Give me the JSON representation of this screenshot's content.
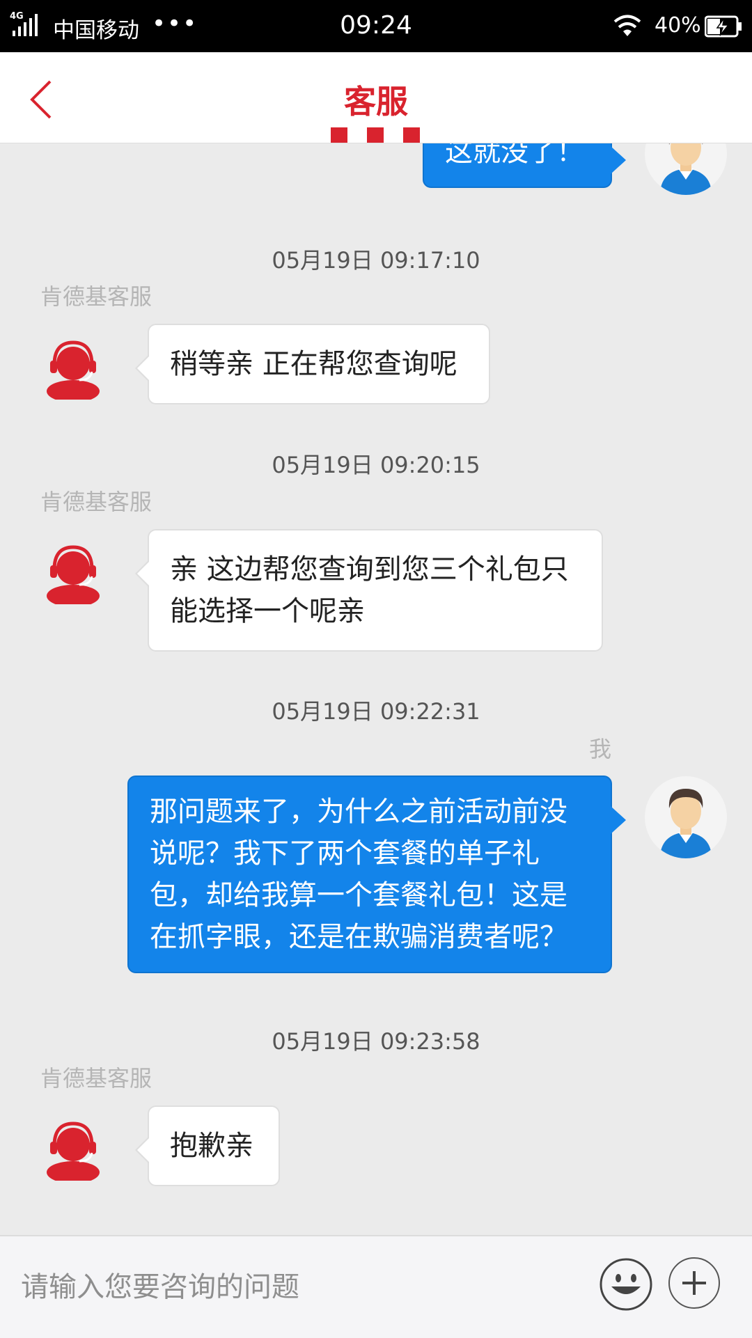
{
  "status_bar": {
    "network": "4G",
    "carrier": "中国移动",
    "more": "•••",
    "time": "09:24",
    "battery": "40%"
  },
  "header": {
    "title": "客服",
    "brand_color": "#d9232e"
  },
  "chat": {
    "cs_sender": "肯德基客服",
    "me_sender": "我",
    "messages": [
      {
        "from": "me",
        "text": "这就没了！"
      },
      {
        "time": "05月19日 09:17:10",
        "from": "cs",
        "sender": "肯德基客服",
        "text": "稍等亲 正在帮您查询呢"
      },
      {
        "time": "05月19日 09:20:15",
        "from": "cs",
        "sender": "肯德基客服",
        "text": "亲 这边帮您查询到您三个礼包只能选择一个呢亲"
      },
      {
        "time": "05月19日 09:22:31",
        "from": "me",
        "sender": "我",
        "text": "那问题来了，为什么之前活动前没说呢？我下了两个套餐的单子礼包，却给我算一个套餐礼包！这是在抓字眼，还是在欺骗消费者呢？"
      },
      {
        "time": "05月19日 09:23:58",
        "from": "cs",
        "sender": "肯德基客服",
        "text": "抱歉亲"
      }
    ],
    "bubble_out_color": "#1384ea"
  },
  "input": {
    "placeholder": "请输入您要咨询的问题",
    "value": ""
  },
  "icons": {
    "back": "chevron-left-icon",
    "emoji": "smiley-icon",
    "plus": "plus-icon",
    "cs_avatar": "headset-agent-icon",
    "me_avatar": "user-avatar-icon"
  }
}
